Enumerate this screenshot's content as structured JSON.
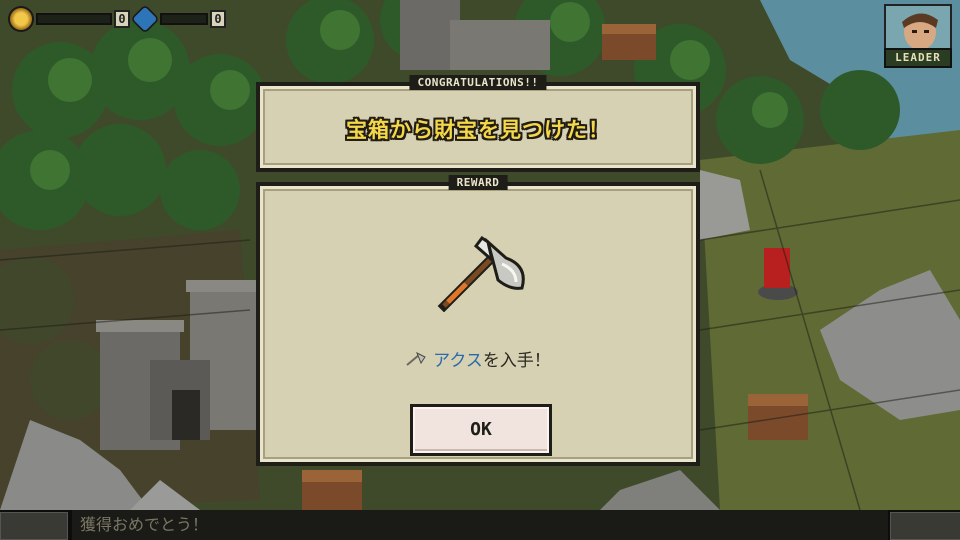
{
  "hud": {
    "gold_value": "0",
    "crystal_value": "0",
    "leader_label": "LEADER"
  },
  "dialog": {
    "congrats_tab": "CONGRATULATIONS!!",
    "message": "宝箱から財宝を見つけた！",
    "reward_tab": "REWARD",
    "reward_item": "アクス",
    "reward_suffix": "を入手！",
    "ok_label": "OK"
  },
  "chat": {
    "text": "獲得おめでとう！"
  },
  "colors": {
    "headline": "#f4d84a",
    "item_name": "#2b6aa8",
    "panel_bg": "#d7d1b3"
  },
  "icons": [
    "gold-coin-icon",
    "crystal-icon",
    "axe-icon",
    "small-axe-icon",
    "leader-portrait"
  ]
}
